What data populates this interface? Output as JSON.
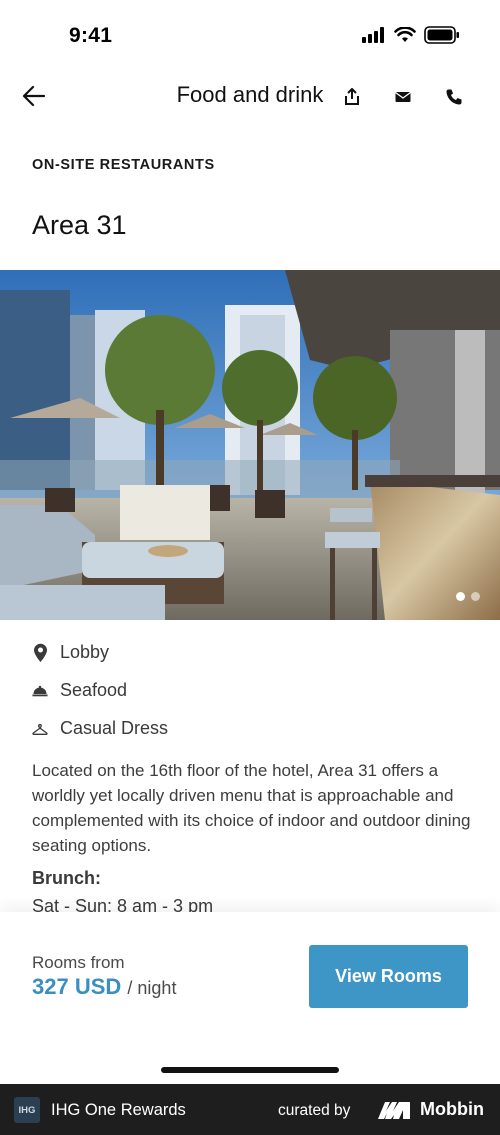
{
  "status_bar": {
    "time": "9:41"
  },
  "header": {
    "title": "Food and drink"
  },
  "section": {
    "label": "ON-SITE RESTAURANTS"
  },
  "restaurant": {
    "name": "Area 31",
    "location": "Lobby",
    "cuisine": "Seafood",
    "dress_code": "Casual Dress",
    "description": "Located on the 16th floor of the hotel, Area 31 offers a worldly yet locally driven menu that is approachable and complemented with its choice of indoor and outdoor dining seating options.",
    "brunch_label": "Brunch:",
    "brunch_hours": "Sat - Sun: 8 am - 3 pm"
  },
  "gallery": {
    "total": 2,
    "current": 1
  },
  "booking": {
    "rooms_from_label": "Rooms from",
    "price": "327 USD",
    "per_night": "/ night",
    "cta": "View Rooms"
  },
  "footer": {
    "badge": "IHG",
    "app_name": "IHG One Rewards",
    "curated_by": "curated by",
    "brand": "Mobbin"
  },
  "colors": {
    "accent": "#3e96c6",
    "price": "#3b8fc0",
    "footer_bg": "#1e1e1e"
  },
  "icons": {
    "back": "arrow-left-icon",
    "share": "share-icon",
    "email": "mail-icon",
    "call": "phone-icon",
    "location": "map-pin-icon",
    "cuisine": "cloche-icon",
    "dress": "hanger-icon"
  }
}
